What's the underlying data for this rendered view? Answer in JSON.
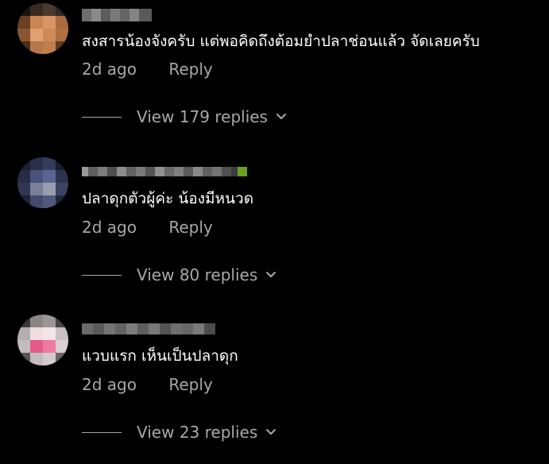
{
  "comments": [
    {
      "text": "สงสารน้องจังครับ แต่พอคิดถึงต้อมยำปลาช่อนแล้ว จัดเลยครับ",
      "age": "2d ago",
      "reply_label": "Reply",
      "view_replies_label": "View 179 replies"
    },
    {
      "text": "ปลาดุกตัวผู้ค่ะ น้องมีหนวด",
      "age": "2d ago",
      "reply_label": "Reply",
      "view_replies_label": "View 80 replies"
    },
    {
      "text": "แวบแรก เห็นเป็นปลาดุก",
      "age": "2d ago",
      "reply_label": "Reply",
      "view_replies_label": "View 23 replies"
    }
  ],
  "colors": {
    "background": "#000000",
    "primary_text": "#ffffff",
    "secondary_text": "#a8a8a8",
    "username_placeholder": "#6b6b6b"
  },
  "icons": {
    "expand": "chevron-down-icon",
    "avatar": "blurred-avatar-image",
    "username": "pixelated-username-image"
  }
}
